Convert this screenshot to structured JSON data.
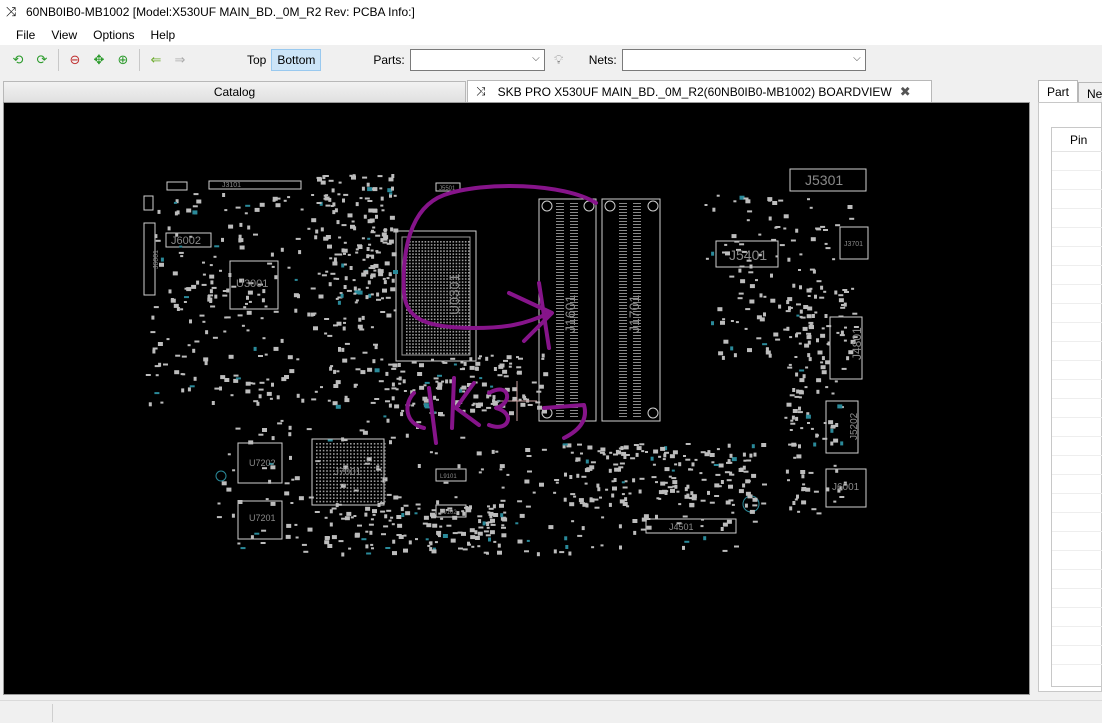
{
  "window": {
    "title": "60NB0IB0-MB1002 [Model:X530UF MAIN_BD._0M_R2 Rev: PCBA Info:]",
    "app_icon": "crossed-arrows-icon"
  },
  "menu": [
    "File",
    "View",
    "Options",
    "Help"
  ],
  "toolbar": {
    "buttons": [
      "refresh-green-icon",
      "refresh-cycle-icon",
      "zoom-out-icon",
      "fit-view-icon",
      "zoom-in-icon",
      "back-arrow-icon",
      "forward-arrow-icon"
    ],
    "layer_top": "Top",
    "layer_bottom": "Bottom",
    "active_layer": "Bottom",
    "parts_label": "Parts:",
    "parts_value": "",
    "nets_label": "Nets:",
    "nets_value": "",
    "bulb_icon": "lightbulb-icon"
  },
  "tabs": {
    "catalog": "Catalog",
    "boardview": "SKB PRO X530UF MAIN_BD._0M_R2(60NB0IB0-MB1002) BOARDVIEW"
  },
  "side_tabs": [
    "Part",
    "Ne"
  ],
  "side_table": {
    "header": "Pin"
  },
  "board": {
    "background": "#000000",
    "outline_color": "#cfcfcf",
    "annotation_color": "#8b1a8b",
    "labels": [
      "J3101",
      "J6002",
      "J6001",
      "U3001",
      "U0301",
      "J1601",
      "J1701",
      "J5401",
      "J5301",
      "J3701",
      "J4801",
      "J5202",
      "J6001",
      "J4501",
      "U7202",
      "U7201",
      "J7001",
      "L9101",
      "L9102",
      "J5501"
    ],
    "annotation_text": "1k3"
  }
}
